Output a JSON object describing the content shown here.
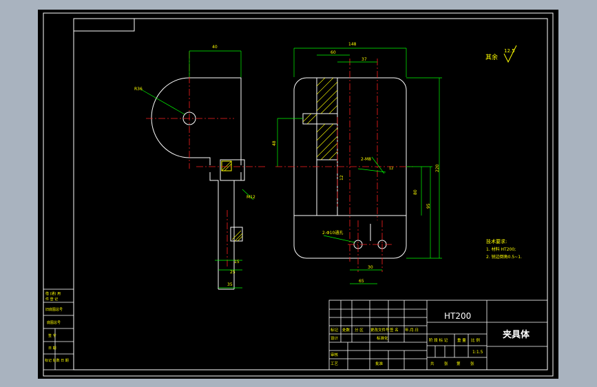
{
  "roughness_note": {
    "label": "其余",
    "value": "12.5"
  },
  "left_view": {
    "radius": "R36",
    "top_width": "40",
    "thread_label": "M12",
    "bottom_15": "15",
    "bottom_25": "25",
    "bottom_35": "35"
  },
  "front_view": {
    "overall_width": "148",
    "w60": "60",
    "w37": "37",
    "height_48": "48",
    "height_220": "220",
    "height_80": "80",
    "height_95": "95",
    "hole_label": "2-M8",
    "dim_12": "12",
    "holes_label": "2-Φ10通孔",
    "bottom_30": "30",
    "bottom_65": "65"
  },
  "tech_req": {
    "title": "技术要求:",
    "line1": "1. 材料 HT200;",
    "line2": "2. 锐边倒角0.5~1."
  },
  "title_block": {
    "material": "HT200",
    "part_name": "夹具体",
    "scale": "1:1.5",
    "row1": [
      "标记",
      "处数",
      "分 区",
      "更改文件号",
      "签 名",
      "年.月.日"
    ],
    "design": "设计",
    "std": "标准化",
    "stage_row": [
      "阶 段 标 记",
      "重 量",
      "比 例"
    ],
    "check": "审核",
    "process": "工艺",
    "approve": "批准",
    "sheets": [
      "共",
      "张",
      "第",
      "张"
    ]
  },
  "side_table": [
    "借 (通) 用",
    "件 登 记",
    "旧底图总号",
    "底图总号",
    "签 字",
    "日 期",
    "标记 处数 日 期"
  ]
}
